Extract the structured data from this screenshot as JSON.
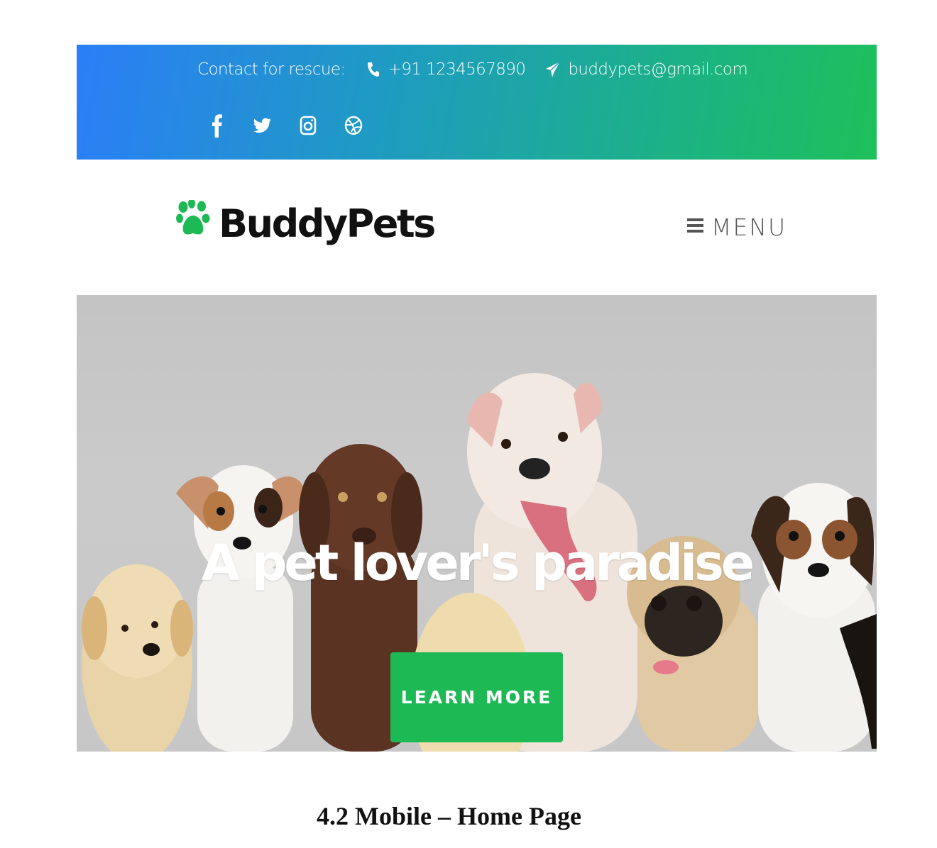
{
  "topbar": {
    "contact_label": "Contact for rescue:",
    "phone": "+91 1234567890",
    "email": "buddypets@gmail.com",
    "socials": [
      "facebook-icon",
      "twitter-icon",
      "instagram-icon",
      "dribbble-icon"
    ]
  },
  "header": {
    "brand": "BuddyPets",
    "menu_label": "MENU"
  },
  "hero": {
    "title": "A pet lover's paradise",
    "cta_label": "LEARN MORE"
  },
  "caption": "4.2  Mobile – Home Page",
  "colors": {
    "gradient_start": "#2b7ef7",
    "gradient_end": "#1ec05a",
    "accent_green": "#1db954",
    "brand_text": "#111111"
  }
}
